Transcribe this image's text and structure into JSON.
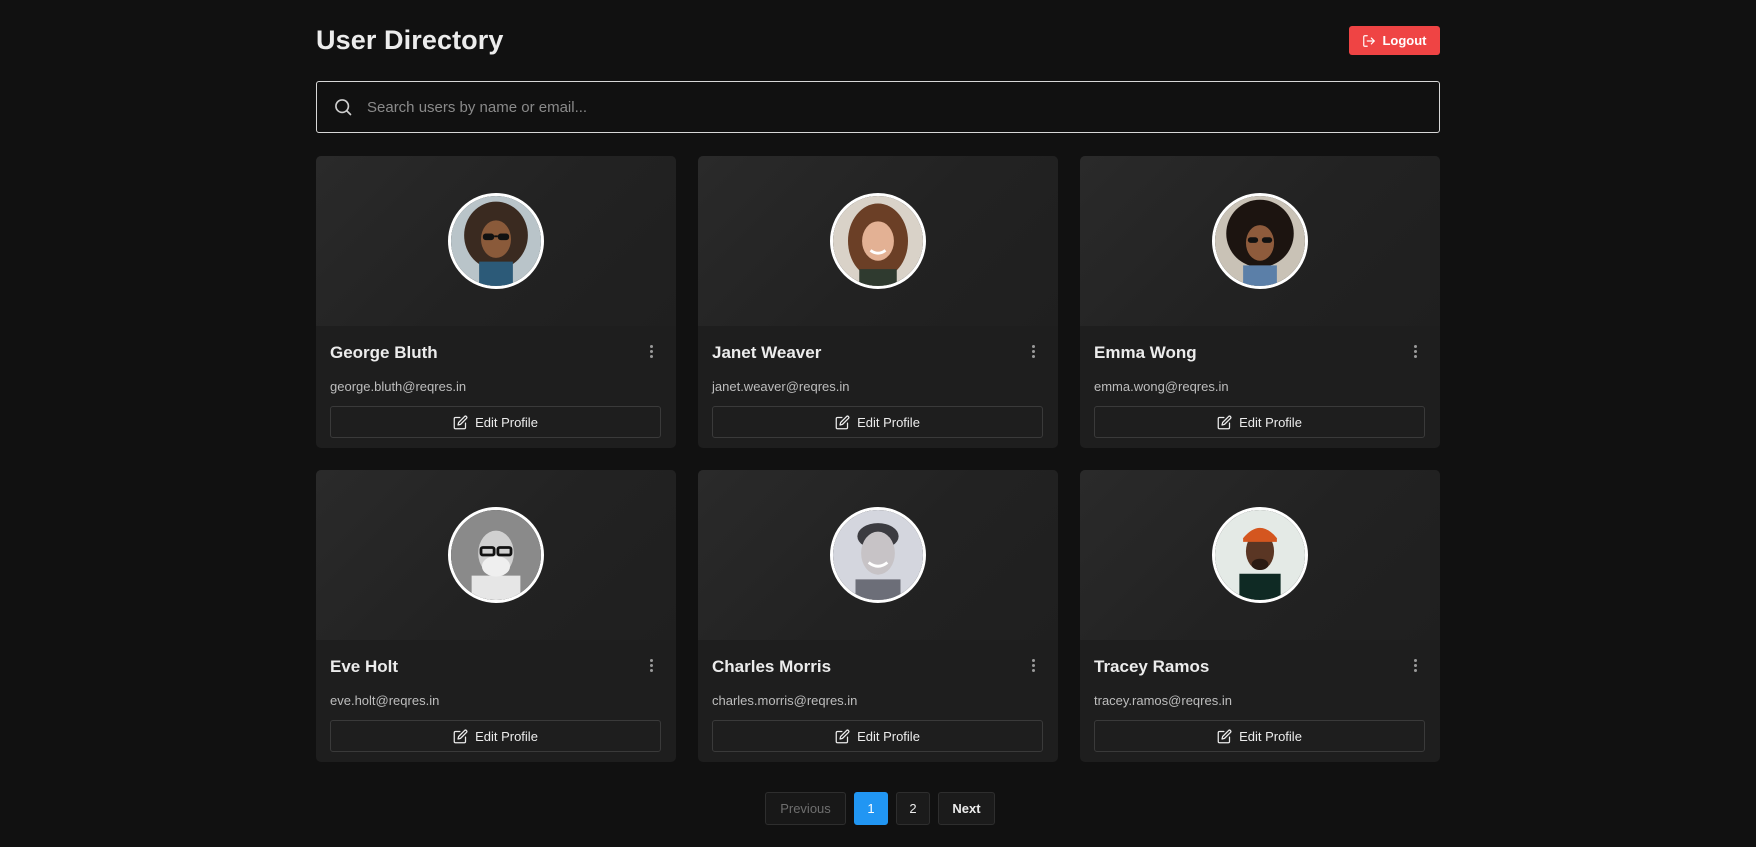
{
  "header": {
    "title": "User Directory",
    "logout_label": "Logout"
  },
  "search": {
    "placeholder": "Search users by name or email...",
    "value": ""
  },
  "users": [
    {
      "name": "George Bluth",
      "email": "george.bluth@reqres.in",
      "edit_label": "Edit Profile"
    },
    {
      "name": "Janet Weaver",
      "email": "janet.weaver@reqres.in",
      "edit_label": "Edit Profile"
    },
    {
      "name": "Emma Wong",
      "email": "emma.wong@reqres.in",
      "edit_label": "Edit Profile"
    },
    {
      "name": "Eve Holt",
      "email": "eve.holt@reqres.in",
      "edit_label": "Edit Profile"
    },
    {
      "name": "Charles Morris",
      "email": "charles.morris@reqres.in",
      "edit_label": "Edit Profile"
    },
    {
      "name": "Tracey Ramos",
      "email": "tracey.ramos@reqres.in",
      "edit_label": "Edit Profile"
    }
  ],
  "pagination": {
    "previous_label": "Previous",
    "pages": [
      "1",
      "2"
    ],
    "current_page": "1",
    "next_label": "Next"
  },
  "colors": {
    "background": "#111111",
    "card": "#1e1e1e",
    "logout": "#ef4444",
    "active_page": "#2196f3"
  },
  "icons": {
    "logout": "logout-icon",
    "search": "search-icon",
    "edit": "edit-icon",
    "menu": "more-vertical-icon"
  }
}
